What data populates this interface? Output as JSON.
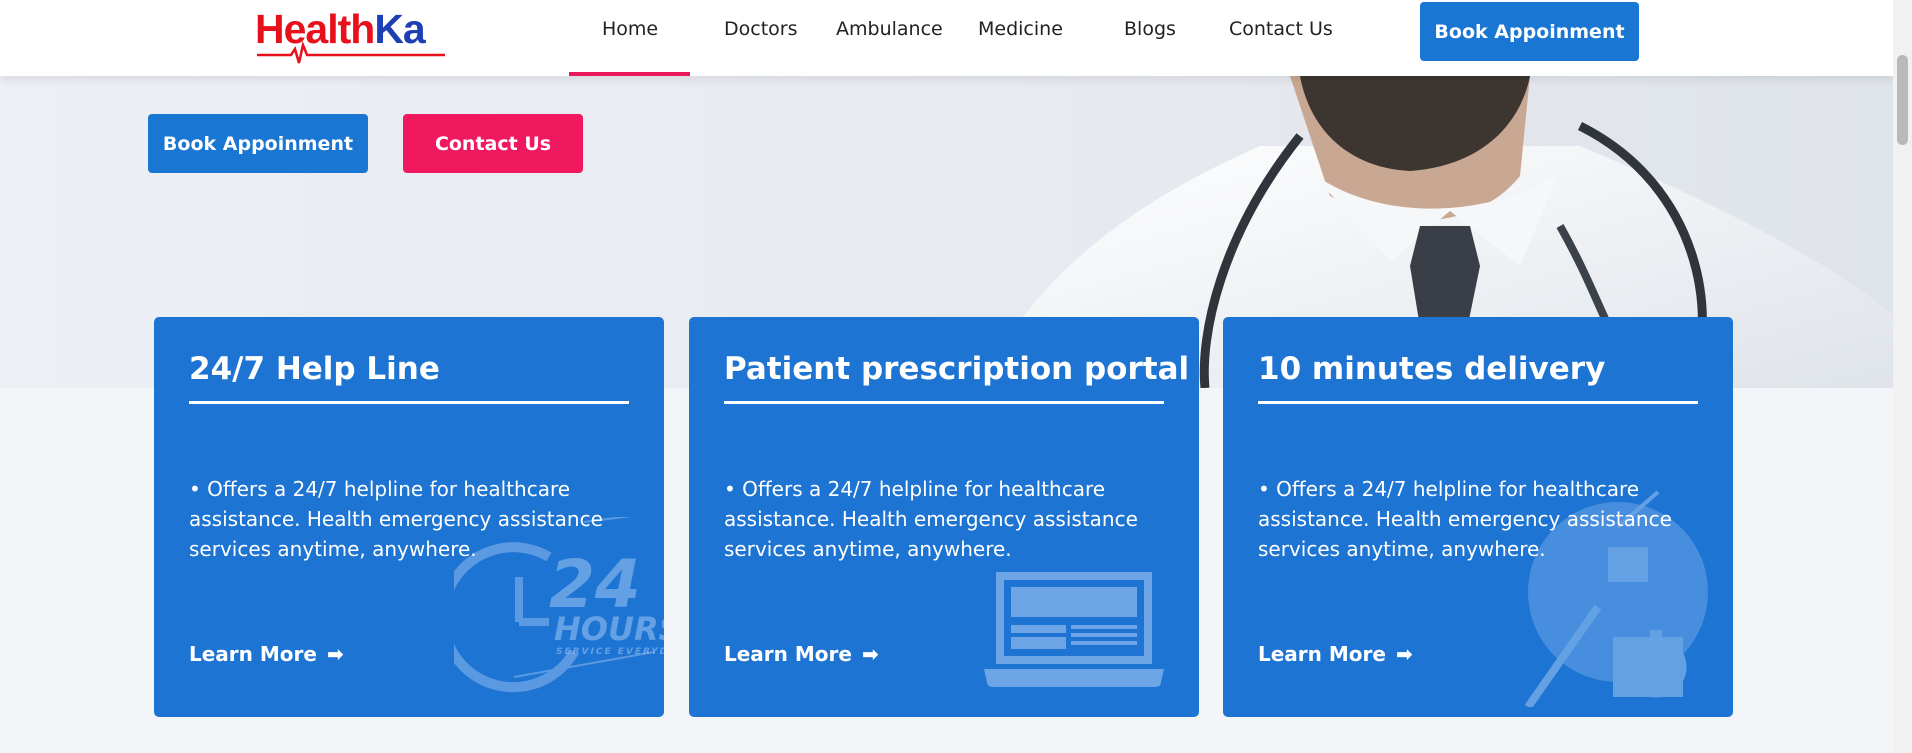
{
  "header": {
    "logo": {
      "part1": "Health",
      "part2": "Ka"
    },
    "nav": [
      {
        "label": "Home",
        "active": true
      },
      {
        "label": "Doctors"
      },
      {
        "label": "Ambulance"
      },
      {
        "label": "Medicine"
      },
      {
        "label": "Blogs"
      },
      {
        "label": "Contact Us"
      }
    ],
    "cta_label": "Book Appoinment"
  },
  "hero": {
    "book_label": "Book Appoinment",
    "contact_label": "Contact Us"
  },
  "cards": [
    {
      "title": "24/7 Help Line",
      "description": "• Offers a 24/7 helpline for healthcare assistance. Health emergency assistance services anytime, anywhere.",
      "link": "Learn More",
      "icon": "24-hours-icon"
    },
    {
      "title": "Patient prescription portal",
      "description": "• Offers a 24/7 helpline for healthcare assistance. Health emergency assistance services anytime, anywhere.",
      "link": "Learn More",
      "icon": "laptop-icon"
    },
    {
      "title": "10 minutes delivery",
      "description": "• Offers a 24/7 helpline for healthcare assistance. Health emergency assistance services anytime, anywhere.",
      "link": "Learn More",
      "icon": "delivery-stopwatch-icon"
    }
  ],
  "colors": {
    "primary_blue": "#1976d2",
    "card_blue": "#1d74d3",
    "accent_pink": "#f0185e",
    "logo_red": "#e8111b",
    "logo_navy": "#1e3fb4"
  }
}
